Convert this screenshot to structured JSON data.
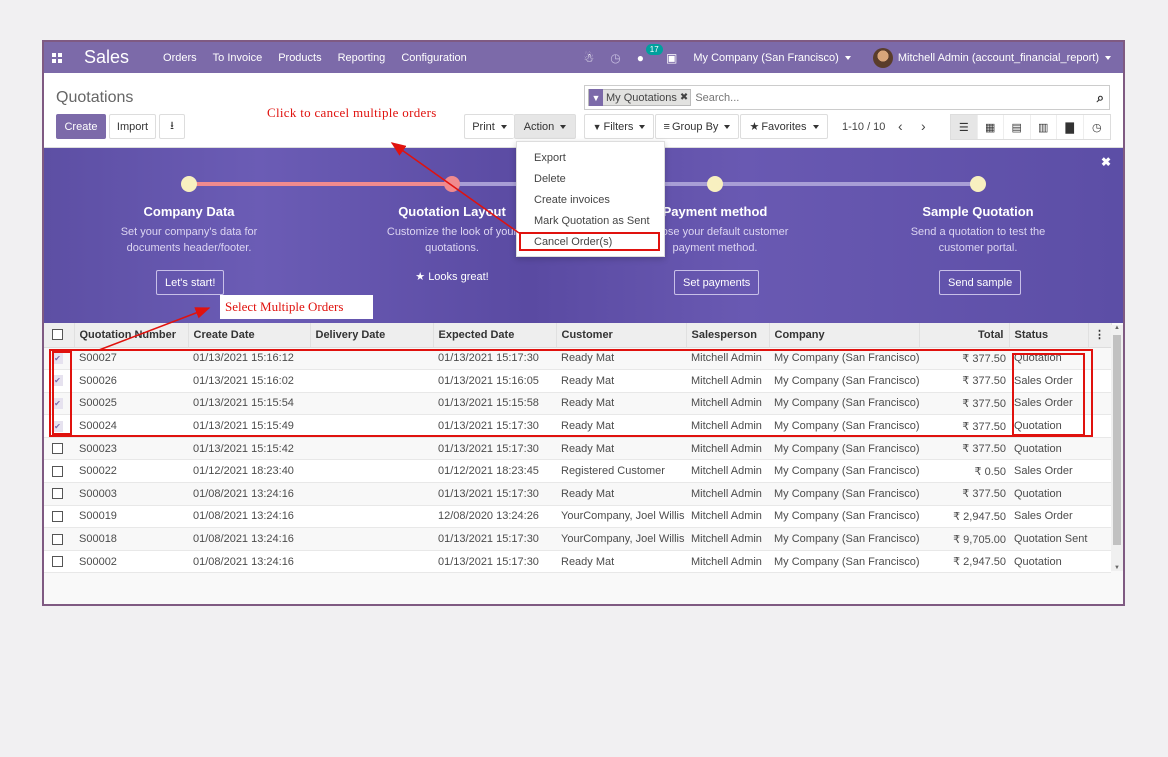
{
  "navbar": {
    "app_name": "Sales",
    "menu": [
      "Orders",
      "To Invoice",
      "Products",
      "Reporting",
      "Configuration"
    ],
    "icons": [
      "bug-icon",
      "clock-icon",
      "chat-icon",
      "gift-icon"
    ],
    "messages_count": "17",
    "company": "My Company (San Francisco)",
    "user": "Mitchell Admin (account_financial_report)",
    "accent_color": "#7c6aa9"
  },
  "control": {
    "title": "Quotations",
    "create_label": "Create",
    "import_label": "Import",
    "print_label": "Print",
    "action_label": "Action",
    "search": {
      "facet": "My Quotations",
      "placeholder": "Search..."
    },
    "filters_label": "Filters",
    "groupby_label": "Group By",
    "favorites_label": "Favorites",
    "pager": "1-10 / 10",
    "views": [
      "list",
      "kanban",
      "calendar",
      "pivot",
      "graph",
      "activity"
    ]
  },
  "action_menu": {
    "items": [
      "Export",
      "Delete",
      "Create invoices",
      "Mark Quotation as Sent",
      "Cancel Order(s)"
    ]
  },
  "banner": {
    "steps": [
      {
        "title": "Company Data",
        "desc1": "Set your company's data for",
        "desc2": "documents header/footer.",
        "button": "Let's start!"
      },
      {
        "title": "Quotation Layout",
        "desc1": "Customize the look of your",
        "desc2": "quotations.",
        "done": "Looks great!"
      },
      {
        "title": "Payment method",
        "desc1": "Choose your default customer",
        "desc2": "payment method.",
        "button": "Set payments"
      },
      {
        "title": "Sample Quotation",
        "desc1": "Send a quotation to test the",
        "desc2": "customer portal.",
        "button": "Send sample"
      }
    ]
  },
  "annotations": {
    "cancel": "Click to cancel multiple orders",
    "select": "Select Multiple Orders"
  },
  "table": {
    "columns": [
      "Quotation Number",
      "Create Date",
      "Delivery Date",
      "Expected Date",
      "Customer",
      "Salesperson",
      "Company",
      "Total",
      "Status"
    ],
    "rows": [
      {
        "checked": true,
        "number": "S00027",
        "create": "01/13/2021 15:16:12",
        "delivery": "",
        "expected": "01/13/2021 15:17:30",
        "customer": "Ready Mat",
        "salesperson": "Mitchell Admin",
        "company": "My Company (San Francisco)",
        "total": "₹ 377.50",
        "status": "Quotation"
      },
      {
        "checked": true,
        "number": "S00026",
        "create": "01/13/2021 15:16:02",
        "delivery": "",
        "expected": "01/13/2021 15:16:05",
        "customer": "Ready Mat",
        "salesperson": "Mitchell Admin",
        "company": "My Company (San Francisco)",
        "total": "₹ 377.50",
        "status": "Sales Order"
      },
      {
        "checked": true,
        "number": "S00025",
        "create": "01/13/2021 15:15:54",
        "delivery": "",
        "expected": "01/13/2021 15:15:58",
        "customer": "Ready Mat",
        "salesperson": "Mitchell Admin",
        "company": "My Company (San Francisco)",
        "total": "₹ 377.50",
        "status": "Sales Order"
      },
      {
        "checked": true,
        "number": "S00024",
        "create": "01/13/2021 15:15:49",
        "delivery": "",
        "expected": "01/13/2021 15:17:30",
        "customer": "Ready Mat",
        "salesperson": "Mitchell Admin",
        "company": "My Company (San Francisco)",
        "total": "₹ 377.50",
        "status": "Quotation"
      },
      {
        "checked": false,
        "number": "S00023",
        "create": "01/13/2021 15:15:42",
        "delivery": "",
        "expected": "01/13/2021 15:17:30",
        "customer": "Ready Mat",
        "salesperson": "Mitchell Admin",
        "company": "My Company (San Francisco)",
        "total": "₹ 377.50",
        "status": "Quotation"
      },
      {
        "checked": false,
        "number": "S00022",
        "create": "01/12/2021 18:23:40",
        "delivery": "",
        "expected": "01/12/2021 18:23:45",
        "customer": "Registered Customer",
        "salesperson": "Mitchell Admin",
        "company": "My Company (San Francisco)",
        "total": "₹ 0.50",
        "status": "Sales Order"
      },
      {
        "checked": false,
        "number": "S00003",
        "create": "01/08/2021 13:24:16",
        "delivery": "",
        "expected": "01/13/2021 15:17:30",
        "customer": "Ready Mat",
        "salesperson": "Mitchell Admin",
        "company": "My Company (San Francisco)",
        "total": "₹ 377.50",
        "status": "Quotation"
      },
      {
        "checked": false,
        "number": "S00019",
        "create": "01/08/2021 13:24:16",
        "delivery": "",
        "expected": "12/08/2020 13:24:26",
        "customer": "YourCompany, Joel Willis",
        "salesperson": "Mitchell Admin",
        "company": "My Company (San Francisco)",
        "total": "₹ 2,947.50",
        "status": "Sales Order"
      },
      {
        "checked": false,
        "number": "S00018",
        "create": "01/08/2021 13:24:16",
        "delivery": "",
        "expected": "01/13/2021 15:17:30",
        "customer": "YourCompany, Joel Willis",
        "salesperson": "Mitchell Admin",
        "company": "My Company (San Francisco)",
        "total": "₹ 9,705.00",
        "status": "Quotation Sent"
      },
      {
        "checked": false,
        "number": "S00002",
        "create": "01/08/2021 13:24:16",
        "delivery": "",
        "expected": "01/13/2021 15:17:30",
        "customer": "Ready Mat",
        "salesperson": "Mitchell Admin",
        "company": "My Company (San Francisco)",
        "total": "₹ 2,947.50",
        "status": "Quotation"
      }
    ]
  }
}
